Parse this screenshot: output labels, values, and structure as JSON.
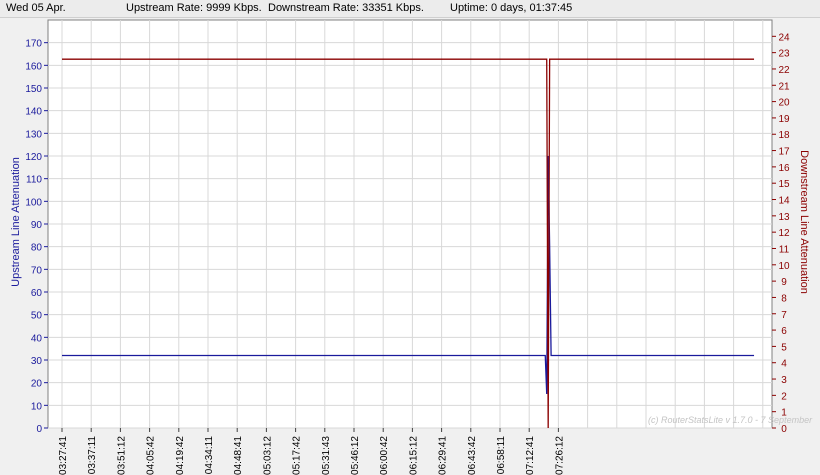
{
  "status": {
    "date": "Wed 05 Apr.",
    "upstream": "Upstream Rate: 9999 Kbps.",
    "downstream": "Downstream Rate: 33351 Kbps.",
    "uptime": "Uptime: 0 days, 01:37:45"
  },
  "watermark": "(c) RouterStatsLite v 1.7.0 - 7 September",
  "colors": {
    "upstream": "#1a1a9c",
    "downstream": "#8b0000",
    "grid": "#d8d8d8",
    "plot_bg": "#ffffff"
  },
  "chart_data": {
    "type": "line",
    "title": "",
    "xlabel": "",
    "ylabel_left": "Upstream Line Attenuation",
    "ylabel_right": "Downstream Line Attenuation",
    "ylim_left": [
      0,
      180
    ],
    "ylim_right": [
      0,
      25
    ],
    "yticks_left": [
      0,
      10,
      20,
      30,
      40,
      50,
      60,
      70,
      80,
      90,
      100,
      110,
      120,
      130,
      140,
      150,
      160,
      170
    ],
    "yticks_right": [
      0,
      1,
      2,
      3,
      4,
      5,
      6,
      7,
      8,
      9,
      10,
      11,
      12,
      13,
      14,
      15,
      16,
      17,
      18,
      19,
      20,
      21,
      22,
      23,
      24
    ],
    "x_tick_labels": [
      "03:27:41",
      "03:37:11",
      "03:51:12",
      "04:05:42",
      "04:19:42",
      "04:34:11",
      "04:48:41",
      "05:03:12",
      "05:17:42",
      "05:31:43",
      "05:46:12",
      "06:00:42",
      "06:15:12",
      "06:29:41",
      "06:43:42",
      "06:58:11",
      "07:12:41",
      "07:26:12"
    ],
    "grid": true,
    "series": [
      {
        "name": "Upstream Line Attenuation",
        "axis": "left",
        "points": [
          [
            0,
            32
          ],
          [
            16.55,
            32
          ],
          [
            16.6,
            15
          ],
          [
            16.65,
            120
          ],
          [
            16.7,
            80
          ],
          [
            16.75,
            32
          ],
          [
            23.7,
            32
          ]
        ]
      },
      {
        "name": "Downstream Line Attenuation",
        "axis": "right",
        "points": [
          [
            0,
            22.6
          ],
          [
            16.6,
            22.6
          ],
          [
            16.65,
            0
          ],
          [
            16.7,
            22.6
          ],
          [
            16.85,
            22.6
          ],
          [
            23.7,
            22.6
          ]
        ]
      }
    ]
  }
}
